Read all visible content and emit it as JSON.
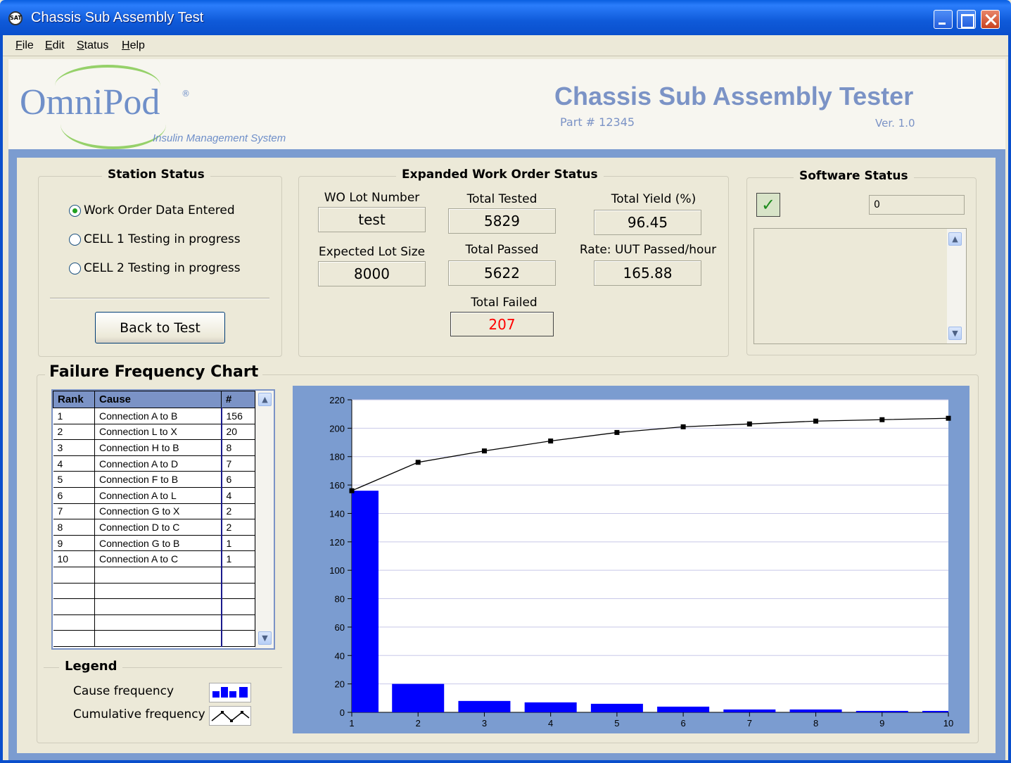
{
  "window": {
    "title": "Chassis Sub Assembly Test",
    "app_icon_text": "SAT"
  },
  "menu": {
    "file": {
      "first": "F",
      "rest": "ile"
    },
    "edit": {
      "first": "E",
      "rest": "dit"
    },
    "status": {
      "first": "S",
      "rest": "tatus"
    },
    "help": {
      "first": "H",
      "rest": "elp"
    }
  },
  "header": {
    "logo_text": "OmniPod",
    "logo_reg": "®",
    "logo_tagline": "Insulin Management System",
    "title": "Chassis Sub Assembly Tester",
    "part": "Part # 12345",
    "version": "Ver.   1.0"
  },
  "station_status": {
    "title": "Station Status",
    "options": [
      {
        "label": "Work Order Data Entered",
        "selected": true
      },
      {
        "label": "CELL 1 Testing in progress",
        "selected": false
      },
      {
        "label": "CELL 2 Testing in progress",
        "selected": false
      }
    ],
    "back_button": "Back to Test"
  },
  "work_order": {
    "title": "Expanded Work Order Status",
    "wo_lot_label": "WO Lot Number",
    "wo_lot_value": "test",
    "expected_lot_label": "Expected Lot Size",
    "expected_lot_value": "8000",
    "total_tested_label": "Total Tested",
    "total_tested_value": "5829",
    "total_passed_label": "Total Passed",
    "total_passed_value": "5622",
    "total_failed_label": "Total Failed",
    "total_failed_value": "207",
    "total_yield_label": "Total Yield (%)",
    "total_yield_value": "96.45",
    "rate_label": "Rate: UUT Passed/hour",
    "rate_value": "165.88",
    "failed_color": "#ff0000"
  },
  "software_status": {
    "title": "Software Status",
    "code_value": "0",
    "check_icon": "check-icon"
  },
  "failure_chart": {
    "title": "Failure Frequency Chart",
    "columns": [
      "Rank",
      "Cause",
      "#"
    ],
    "rows": [
      [
        "1",
        "Connection A to B",
        "156"
      ],
      [
        "2",
        "Connection L to X",
        "20"
      ],
      [
        "3",
        "Connection H to B",
        "8"
      ],
      [
        "4",
        "Connection A to D",
        "7"
      ],
      [
        "5",
        "Connection F to B",
        "6"
      ],
      [
        "6",
        "Connection A to L",
        "4"
      ],
      [
        "7",
        "Connection G to X",
        "2"
      ],
      [
        "8",
        "Connection D to C",
        "2"
      ],
      [
        "9",
        "Connection G to B",
        "1"
      ],
      [
        "10",
        "Connection A to C",
        "1"
      ]
    ],
    "empty_rows": 5,
    "legend_title": "Legend",
    "legend_cause": "Cause frequency",
    "legend_cumulative": "Cumulative frequency"
  },
  "chart_data": {
    "type": "bar",
    "x": [
      1,
      2,
      3,
      4,
      5,
      6,
      7,
      8,
      9,
      10
    ],
    "series": [
      {
        "type": "bar",
        "values": [
          156,
          20,
          8,
          7,
          6,
          4,
          2,
          2,
          1,
          1
        ],
        "color": "#0000ff"
      },
      {
        "type": "line",
        "values": [
          156,
          176,
          184,
          191,
          197,
          201,
          203,
          205,
          206,
          207
        ],
        "color": "#000000"
      }
    ],
    "ylim": [
      0,
      220
    ],
    "yticks": [
      0,
      20,
      40,
      60,
      80,
      100,
      120,
      140,
      160,
      180,
      200,
      220
    ],
    "xticks": [
      1,
      2,
      3,
      4,
      5,
      6,
      7,
      8,
      9,
      10
    ],
    "grid": true
  }
}
